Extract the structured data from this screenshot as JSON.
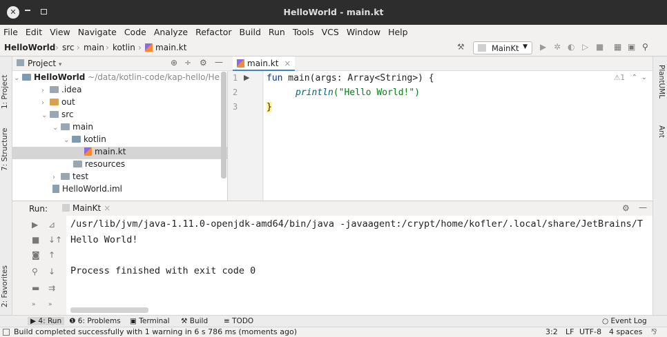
{
  "window": {
    "title": "HelloWorld - main.kt"
  },
  "menu": [
    "File",
    "Edit",
    "View",
    "Navigate",
    "Code",
    "Analyze",
    "Refactor",
    "Build",
    "Run",
    "Tools",
    "VCS",
    "Window",
    "Help"
  ],
  "breadcrumb": {
    "project": "HelloWorld",
    "c1": "src",
    "c2": "main",
    "c3": "kotlin",
    "c4": "main.kt"
  },
  "run_config": "MainKt",
  "project_panel": {
    "title": "Project",
    "tree": [
      {
        "label": "HelloWorld",
        "extra": "~/data/kotlin-code/kap-hello/He"
      },
      {
        "label": ".idea"
      },
      {
        "label": "out"
      },
      {
        "label": "src"
      },
      {
        "label": "main"
      },
      {
        "label": "kotlin"
      },
      {
        "label": "main.kt"
      },
      {
        "label": "resources"
      },
      {
        "label": "test"
      },
      {
        "label": "HelloWorld.iml"
      }
    ]
  },
  "left_stripe": {
    "project": "1: Project",
    "structure": "7: Structure",
    "favorites": "2: Favorites"
  },
  "right_stripe": {
    "plantuml": "PlantUML",
    "ant": "Ant"
  },
  "editor": {
    "tab": "main.kt",
    "line_numbers": [
      "1",
      "2",
      "3"
    ],
    "code": {
      "l1_kw": "fun",
      "l1_rest": " main(args: Array<String>) {",
      "l2_fn": "println",
      "l2_str": "(\"Hello World!\")",
      "l3": "}"
    },
    "warnings": "1"
  },
  "run": {
    "label": "Run:",
    "tab": "MainKt",
    "lines": [
      "/usr/lib/jvm/java-1.11.0-openjdk-amd64/bin/java -javaagent:/crypt/home/kofler/.local/share/JetBrains/T",
      "Hello World!",
      "",
      "Process finished with exit code 0"
    ]
  },
  "tool_tabs": {
    "run": "4: Run",
    "problems": "6: Problems",
    "terminal": "Terminal",
    "build": "Build",
    "todo": "TODO",
    "event_log": "Event Log"
  },
  "status": {
    "message": "Build completed successfully with 1 warning in 6 s 786 ms (moments ago)",
    "position": "3:2",
    "line_sep": "LF",
    "encoding": "UTF-8",
    "indent": "4 spaces"
  }
}
